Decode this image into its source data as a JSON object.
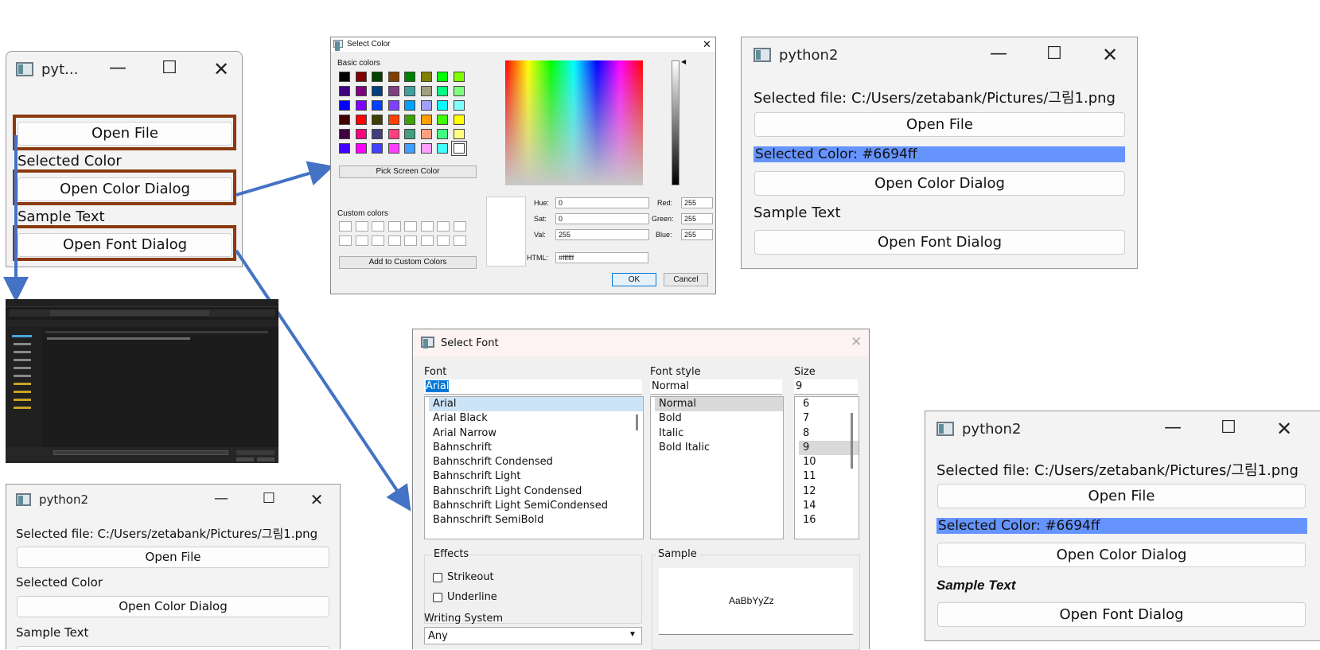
{
  "win_small": {
    "title": "pyt...",
    "open_file": "Open File",
    "color_label": "Selected Color",
    "open_color": "Open Color Dialog",
    "font_label": "Sample Text",
    "open_font": "Open Font Dialog"
  },
  "color_dialog": {
    "title": "Select Color",
    "basic_colors": "Basic colors",
    "pick_screen": "Pick Screen Color",
    "custom_colors": "Custom colors",
    "add_custom": "Add to Custom Colors",
    "hue_label": "Hue:",
    "hue": "0",
    "sat_label": "Sat:",
    "sat": "0",
    "val_label": "Val:",
    "val": "255",
    "red_label": "Red:",
    "red": "255",
    "green_label": "Green:",
    "green": "255",
    "blue_label": "Blue:",
    "blue": "255",
    "html_label": "HTML:",
    "html": "#ffffff",
    "ok": "OK",
    "cancel": "Cancel",
    "swatches": [
      [
        "#000000",
        "#800000",
        "#004000",
        "#804000",
        "#008000",
        "#808000",
        "#00ff00",
        "#80ff00"
      ],
      [
        "#400080",
        "#800080",
        "#004080",
        "#804080",
        "#40a0a0",
        "#a0a080",
        "#00ff80",
        "#80ff80"
      ],
      [
        "#0000ff",
        "#8000ff",
        "#0040ff",
        "#8040ff",
        "#00a0ff",
        "#a0a0ff",
        "#00ffff",
        "#80ffff"
      ],
      [
        "#400000",
        "#ff0000",
        "#404000",
        "#ff4000",
        "#40a000",
        "#ffa000",
        "#40ff00",
        "#ffff00"
      ],
      [
        "#400040",
        "#ff0080",
        "#404080",
        "#ff4080",
        "#40a080",
        "#ffa080",
        "#40ff80",
        "#ffff80"
      ],
      [
        "#4000ff",
        "#ff00ff",
        "#4040ff",
        "#ff40ff",
        "#40a0ff",
        "#ffa0ff",
        "#40ffff",
        "#ffffff"
      ]
    ]
  },
  "win_color": {
    "title": "python2",
    "selected_file": "Selected file: C:/Users/zetabank/Pictures/그림1.png",
    "open_file": "Open File",
    "selected_color": "Selected Color: #6694ff",
    "open_color": "Open Color Dialog",
    "sample": "Sample Text",
    "open_font": "Open Font Dialog"
  },
  "font_dialog": {
    "title": "Select Font",
    "font_label": "Font",
    "font_value": "Arial",
    "style_label": "Font style",
    "style_value": "Normal",
    "size_label": "Size",
    "size_value": "9",
    "fonts": [
      "Arial",
      "Arial Black",
      "Arial Narrow",
      "Bahnschrift",
      "Bahnschrift Condensed",
      "Bahnschrift Light",
      "Bahnschrift Light Condensed",
      "Bahnschrift Light SemiCondensed",
      "Bahnschrift SemiBold"
    ],
    "styles": [
      "Normal",
      "Bold",
      "Italic",
      "Bold Italic"
    ],
    "sizes": [
      "6",
      "7",
      "8",
      "9",
      "10",
      "11",
      "12",
      "14",
      "16"
    ],
    "effects": "Effects",
    "strikeout": "Strikeout",
    "underline": "Underline",
    "writing_system_label": "Writing System",
    "writing_system": "Any",
    "sample_label": "Sample",
    "sample_text": "AaBbYyZz"
  },
  "win_bottom_left": {
    "title": "python2",
    "selected_file": "Selected file: C:/Users/zetabank/Pictures/그림1.png",
    "open_file": "Open File",
    "color_label": "Selected Color",
    "open_color": "Open Color Dialog",
    "sample": "Sample Text"
  },
  "win_font": {
    "title": "python2",
    "selected_file": "Selected file: C:/Users/zetabank/Pictures/그림1.png",
    "open_file": "Open File",
    "selected_color": "Selected Color: #6694ff",
    "open_color": "Open Color Dialog",
    "sample": "Sample Text",
    "open_font": "Open Font Dialog"
  },
  "colors": {
    "accent_blue": "#4472c4",
    "highlight": "#6694ff",
    "frame_brown": "#8b3a0f"
  }
}
